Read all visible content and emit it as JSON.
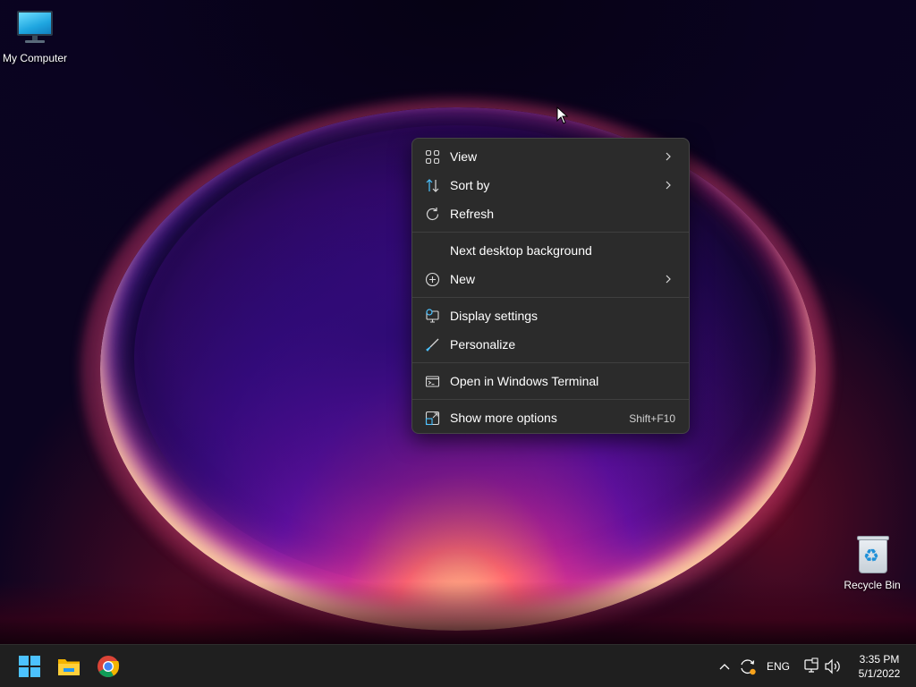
{
  "desktop": {
    "icons": [
      {
        "label": "My Computer",
        "icon": "monitor-icon"
      },
      {
        "label": "Recycle Bin",
        "icon": "recycle-bin-icon"
      }
    ]
  },
  "context_menu": {
    "items": [
      {
        "label": "View",
        "icon": "view-grid-icon",
        "has_submenu": true
      },
      {
        "label": "Sort by",
        "icon": "sort-arrows-icon",
        "has_submenu": true
      },
      {
        "label": "Refresh",
        "icon": "refresh-icon",
        "has_submenu": false
      },
      {
        "label": "Next desktop background",
        "icon": "",
        "has_submenu": false
      },
      {
        "label": "New",
        "icon": "add-circle-icon",
        "has_submenu": true
      },
      {
        "label": "Display settings",
        "icon": "display-settings-icon",
        "has_submenu": false
      },
      {
        "label": "Personalize",
        "icon": "brush-icon",
        "has_submenu": false
      },
      {
        "label": "Open in Windows Terminal",
        "icon": "terminal-icon",
        "has_submenu": false
      },
      {
        "label": "Show more options",
        "icon": "more-options-icon",
        "shortcut": "Shift+F10",
        "has_submenu": false
      }
    ]
  },
  "taskbar": {
    "pinned": [
      {
        "name": "Start",
        "icon": "windows-start-icon"
      },
      {
        "name": "File Explorer",
        "icon": "file-explorer-icon"
      },
      {
        "name": "Google Chrome",
        "icon": "chrome-icon"
      }
    ],
    "tray": {
      "language": "ENG",
      "time": "3:35 PM",
      "date": "5/1/2022"
    }
  },
  "colors": {
    "menu_background": "#2b2b2b",
    "taskbar_background": "#1f1f1f",
    "accent_blue": "#4cc2ff"
  }
}
